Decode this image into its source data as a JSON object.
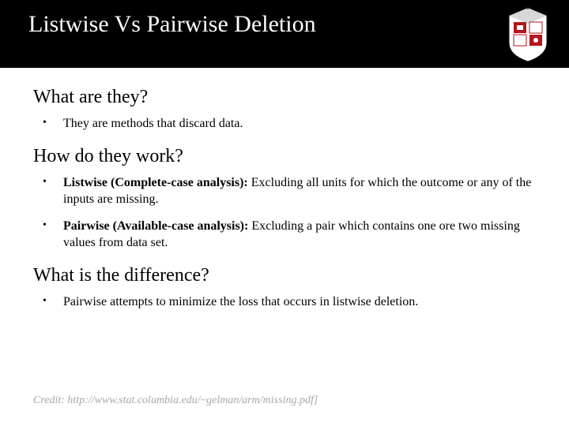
{
  "header": {
    "title": "Listwise Vs Pairwise Deletion"
  },
  "sections": {
    "s1": {
      "heading": "What are they?",
      "bullet1": "They are methods that discard data."
    },
    "s2": {
      "heading": "How do they work?",
      "bullet1_bold": "Listwise (Complete-case analysis): ",
      "bullet1_rest": "Excluding all units for which the outcome or any of the inputs are missing.",
      "bullet2_bold": "Pairwise (Available-case analysis): ",
      "bullet2_rest": "Excluding a pair which contains one ore two missing values from data set."
    },
    "s3": {
      "heading": "What is the difference?",
      "bullet1": "Pairwise attempts to minimize the loss that occurs in listwise deletion."
    }
  },
  "credit": "Credit: http://www.stat.columbia.edu/~gelman/arm/missing.pdf]"
}
